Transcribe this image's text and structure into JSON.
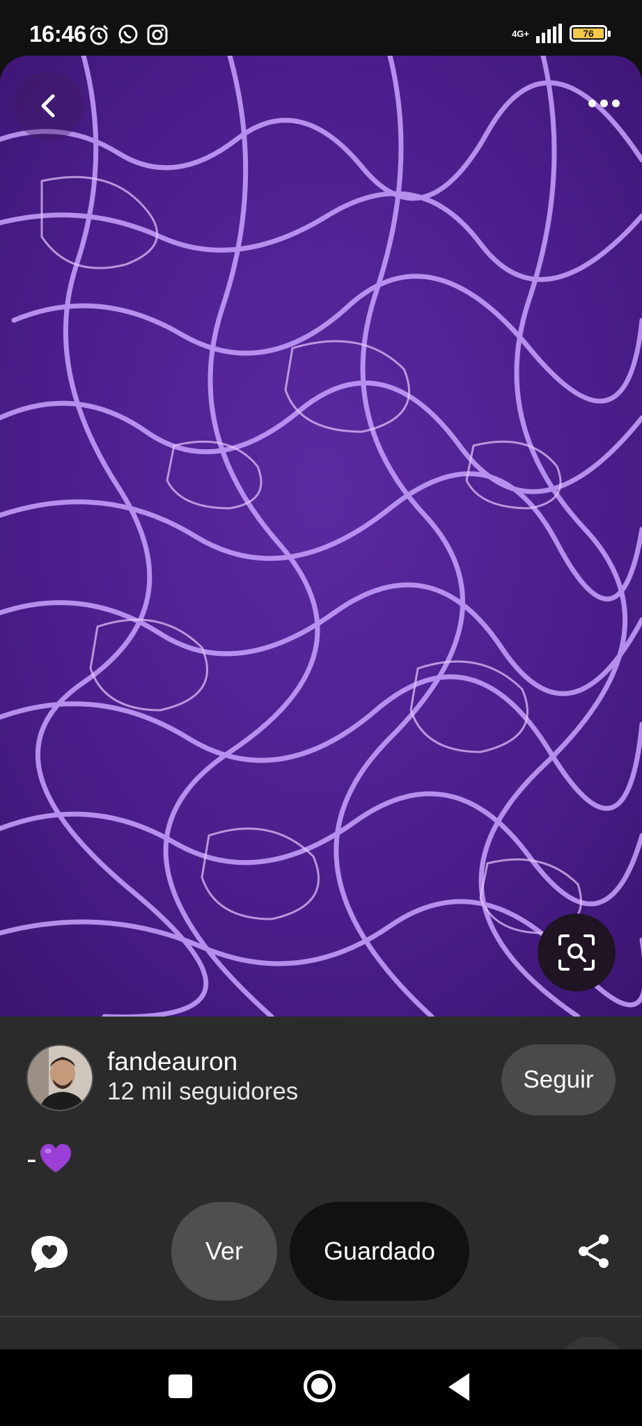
{
  "status_bar": {
    "time": "16:46",
    "icons": [
      "alarm-icon",
      "whatsapp-icon",
      "instagram-icon"
    ],
    "network": "4G+",
    "battery": "76"
  },
  "pin": {
    "image_description_icon": "purple-water-image",
    "back_icon": "chevron-left-icon",
    "more_icon": "more-dots-icon",
    "lens_icon": "visual-search-icon"
  },
  "author": {
    "name": "fandeauron",
    "followers": "12 mil seguidores",
    "follow_label": "Seguir"
  },
  "description": {
    "text": "-",
    "emoji_icon": "purple-heart-icon"
  },
  "actions": {
    "comment_icon": "comment-heart-icon",
    "view_label": "Ver",
    "saved_label": "Guardado",
    "share_icon": "share-icon"
  },
  "colors": {
    "panel": "#2b2b2b",
    "image_base": "#4a1c86",
    "battery": "#f5c84a"
  }
}
